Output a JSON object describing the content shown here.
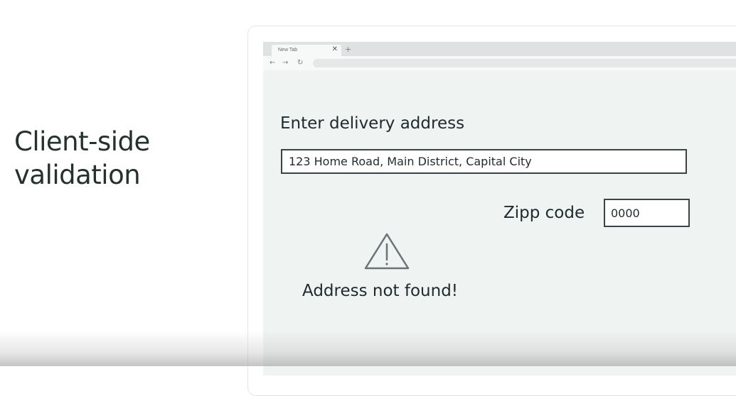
{
  "slide": {
    "title_line1": "Client-side",
    "title_line2": "validation"
  },
  "browser": {
    "tab_label": "New Tab",
    "tab_close": "✕",
    "new_tab": "+",
    "nav_back": "←",
    "nav_forward": "→",
    "nav_reload": "↻"
  },
  "form": {
    "heading": "Enter delivery address",
    "address_value": "123 Home Road, Main District, Capital City",
    "zip_label": "Zipp code",
    "zip_value": "0000",
    "error_message": "Address not found!",
    "error_icon": "warning-triangle-icon"
  }
}
